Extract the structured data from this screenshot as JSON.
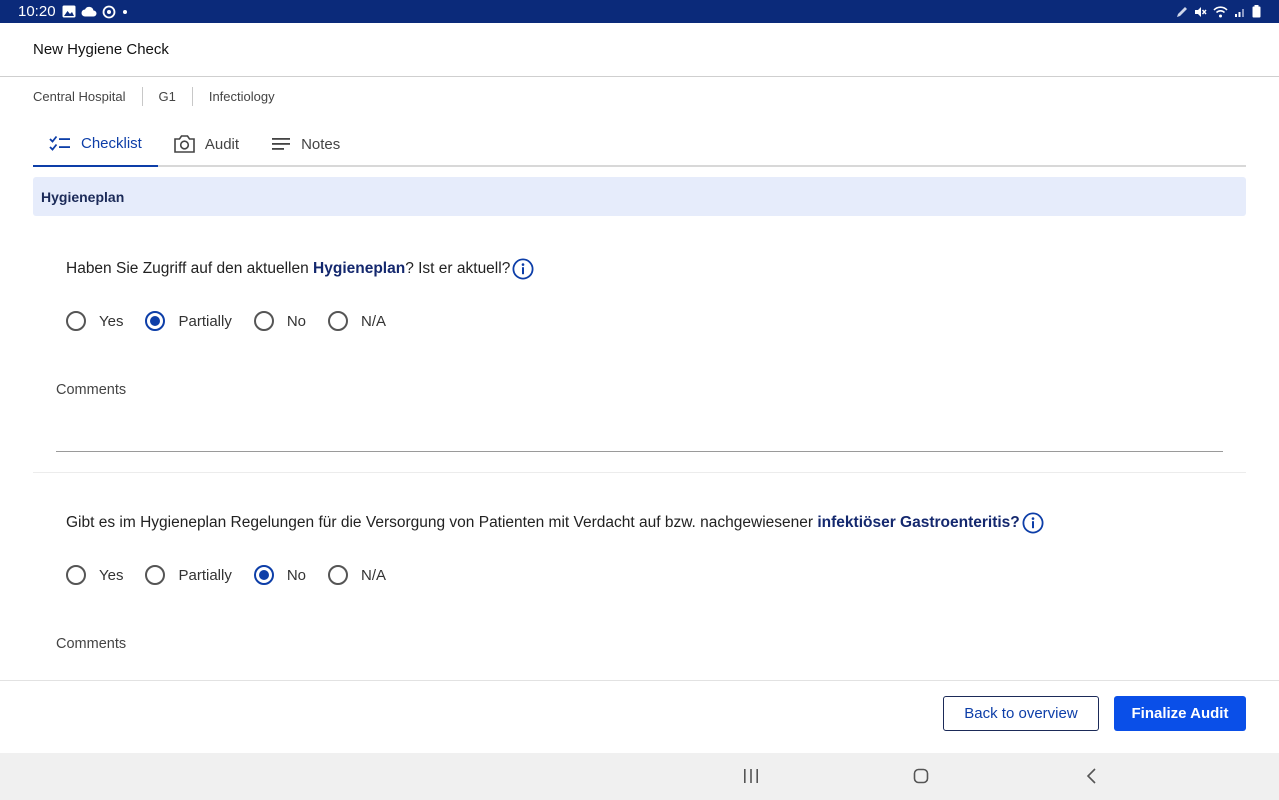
{
  "status_bar": {
    "time": "10:20",
    "left_icons": [
      "image-icon",
      "cloud-icon",
      "sync-icon",
      "dot-icon"
    ],
    "right_icons": [
      "pen-icon",
      "mute-icon",
      "wifi-icon",
      "signal-icon",
      "battery-icon"
    ]
  },
  "app_bar": {
    "title": "New Hygiene Check"
  },
  "breadcrumb": [
    "Central Hospital",
    "G1",
    "Infectiology"
  ],
  "tabs": [
    {
      "label": "Checklist",
      "icon": "checklist-icon",
      "active": true
    },
    {
      "label": "Audit",
      "icon": "camera-icon",
      "active": false
    },
    {
      "label": "Notes",
      "icon": "notes-icon",
      "active": false
    }
  ],
  "section": {
    "title": "Hygieneplan"
  },
  "questions": [
    {
      "text_before": "Haben Sie Zugriff auf den aktuellen ",
      "text_bold": "Hygieneplan",
      "text_after": "? Ist er aktuell?",
      "options": [
        "Yes",
        "Partially",
        "No",
        "N/A"
      ],
      "selected": "Partially",
      "comments_label": "Comments",
      "comments_value": ""
    },
    {
      "text_before": "Gibt es im Hygieneplan Regelungen für die Versorgung von Patienten mit Verdacht auf bzw. nachgewiesener ",
      "text_bold": "infektiöser Gastroenteritis?",
      "text_after": "",
      "options": [
        "Yes",
        "Partially",
        "No",
        "N/A"
      ],
      "selected": "No",
      "comments_label": "Comments",
      "comments_value": ""
    }
  ],
  "footer": {
    "back_label": "Back to overview",
    "finalize_label": "Finalize Audit"
  },
  "nav_bar": {
    "icons": [
      "recents-icon",
      "home-icon",
      "back-icon"
    ]
  },
  "colors": {
    "accent": "#0d3ea8",
    "primary_button": "#0a4fe8",
    "status_bar": "#0b2a7a",
    "section_bg": "#e6ecfb"
  }
}
